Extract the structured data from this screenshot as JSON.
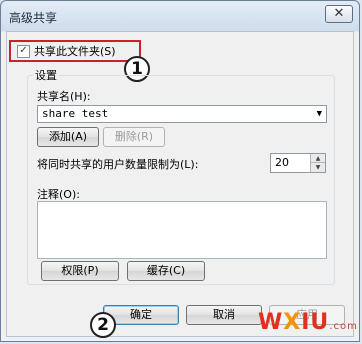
{
  "window": {
    "title": "高级共享",
    "close_label": "✕"
  },
  "share_toggle": {
    "label": "共享此文件夹(S)",
    "checked": true,
    "check_glyph": "✓"
  },
  "markers": {
    "one": "1",
    "two": "2"
  },
  "settings": {
    "group_label": "设置",
    "share_name_label": "共享名(H):",
    "share_name_value": "share test",
    "add_button": "添加(A)",
    "remove_button": "删除(R)",
    "user_limit_label": "将同时共享的用户数量限制为(L):",
    "user_limit_value": "20",
    "comment_label": "注释(O):",
    "permissions_button": "权限(P)",
    "caching_button": "缓存(C)"
  },
  "footer": {
    "ok": "确定",
    "cancel": "取消",
    "apply": "应用"
  },
  "watermark": {
    "part1": "W",
    "part2": "X",
    "part3": "IU",
    "suffix": ".com"
  },
  "colors": {
    "highlight_border": "#c8232c",
    "accent": "#3c7fb1"
  }
}
